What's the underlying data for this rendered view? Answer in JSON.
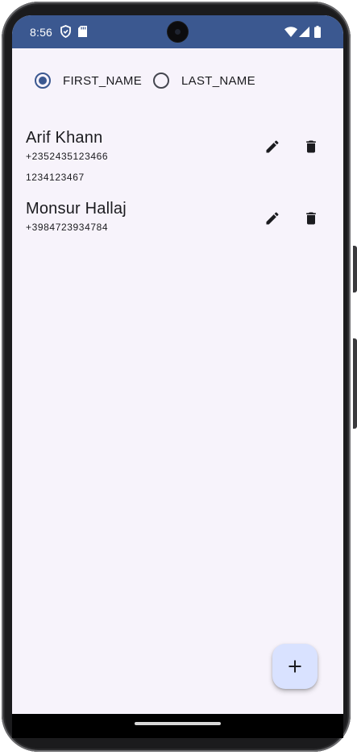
{
  "status_bar": {
    "time": "8:56",
    "left_icons": [
      "shield-icon",
      "sd-card-icon"
    ],
    "right_icons": [
      "wifi-icon",
      "signal-icon",
      "battery-icon"
    ],
    "background_color": "#3b5890"
  },
  "sort_options": {
    "selected": "FIRST_NAME",
    "options": [
      {
        "label": "FIRST_NAME",
        "checked": true
      },
      {
        "label": "LAST_NAME",
        "checked": false
      }
    ]
  },
  "contacts": [
    {
      "name": "Arif Khann",
      "phones": [
        "+2352435123466",
        "1234123467"
      ],
      "actions": [
        "edit-icon",
        "delete-icon"
      ]
    },
    {
      "name": "Monsur Hallaj",
      "phones": [
        "+3984723934784"
      ],
      "actions": [
        "edit-icon",
        "delete-icon"
      ]
    }
  ],
  "fab": {
    "icon": "plus-icon",
    "background_color": "#d9e2ff"
  },
  "colors": {
    "accent": "#3b5890",
    "screen_background": "#f7f3fb",
    "text": "#1b1b1f"
  }
}
